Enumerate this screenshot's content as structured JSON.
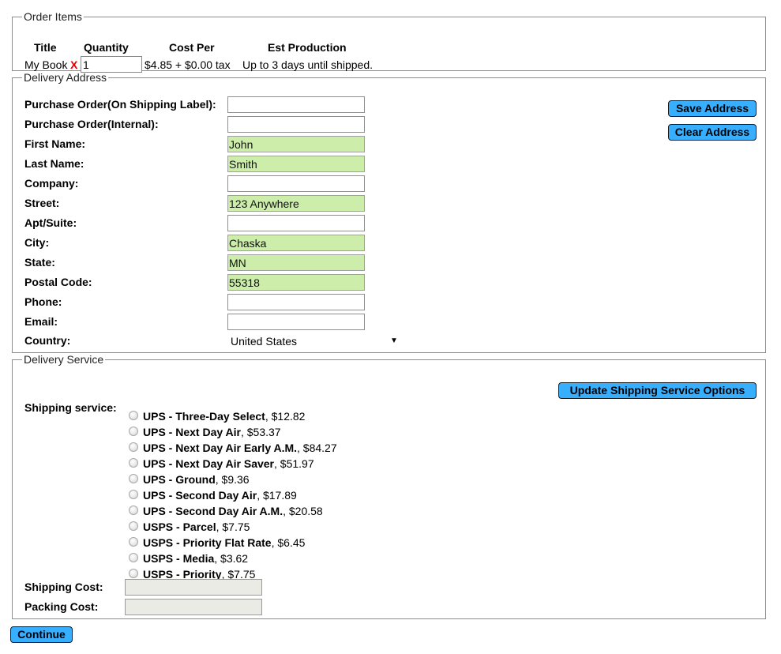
{
  "order_items": {
    "legend": "Order Items",
    "headers": {
      "title": "Title",
      "quantity": "Quantity",
      "cost_per": "Cost Per",
      "est_production": "Est Production"
    },
    "item": {
      "title": "My Book",
      "remove": "X",
      "quantity": "1",
      "cost": "$4.85 + $0.00 tax",
      "production": "Up to 3 days until shipped."
    }
  },
  "delivery_address": {
    "legend": "Delivery Address",
    "save_label": "Save Address",
    "clear_label": "Clear Address",
    "fields": {
      "po_shipping": {
        "label": "Purchase Order(On Shipping Label):",
        "value": ""
      },
      "po_internal": {
        "label": "Purchase Order(Internal):",
        "value": ""
      },
      "first_name": {
        "label": "First Name:",
        "value": "John"
      },
      "last_name": {
        "label": "Last Name:",
        "value": "Smith"
      },
      "company": {
        "label": "Company:",
        "value": ""
      },
      "street": {
        "label": "Street:",
        "value": "123 Anywhere"
      },
      "apt": {
        "label": "Apt/Suite:",
        "value": ""
      },
      "city": {
        "label": "City:",
        "value": "Chaska"
      },
      "state": {
        "label": "State:",
        "value": "MN"
      },
      "postal": {
        "label": "Postal Code:",
        "value": "55318"
      },
      "phone": {
        "label": "Phone:",
        "value": ""
      },
      "email": {
        "label": "Email:",
        "value": ""
      },
      "country": {
        "label": "Country:",
        "value": "United States"
      }
    },
    "filled_color": "#cceeaa"
  },
  "delivery_service": {
    "legend": "Delivery Service",
    "update_label": "Update Shipping Service Options",
    "shipping_label": "Shipping service:",
    "options": [
      {
        "name": "UPS - Three-Day Select",
        "price": ", $12.82"
      },
      {
        "name": "UPS - Next Day Air",
        "price": ", $53.37"
      },
      {
        "name": "UPS - Next Day Air Early A.M.",
        "price": ", $84.27"
      },
      {
        "name": "UPS - Next Day Air Saver",
        "price": ", $51.97"
      },
      {
        "name": "UPS - Ground",
        "price": ", $9.36"
      },
      {
        "name": "UPS - Second Day Air",
        "price": ", $17.89"
      },
      {
        "name": "UPS - Second Day Air A.M.",
        "price": ", $20.58"
      },
      {
        "name": "USPS - Parcel",
        "price": ", $7.75"
      },
      {
        "name": "USPS - Priority Flat Rate",
        "price": ", $6.45"
      },
      {
        "name": "USPS - Media",
        "price": ", $3.62"
      },
      {
        "name": "USPS - Priority",
        "price": ", $7.75"
      }
    ],
    "shipping_cost_label": "Shipping Cost:",
    "packing_cost_label": "Packing Cost:"
  },
  "continue_label": "Continue",
  "colors": {
    "button": "#38aeff",
    "remove": "#e00000"
  },
  "icons": {
    "dropdown": "triangle-down-icon",
    "remove": "x-icon"
  }
}
